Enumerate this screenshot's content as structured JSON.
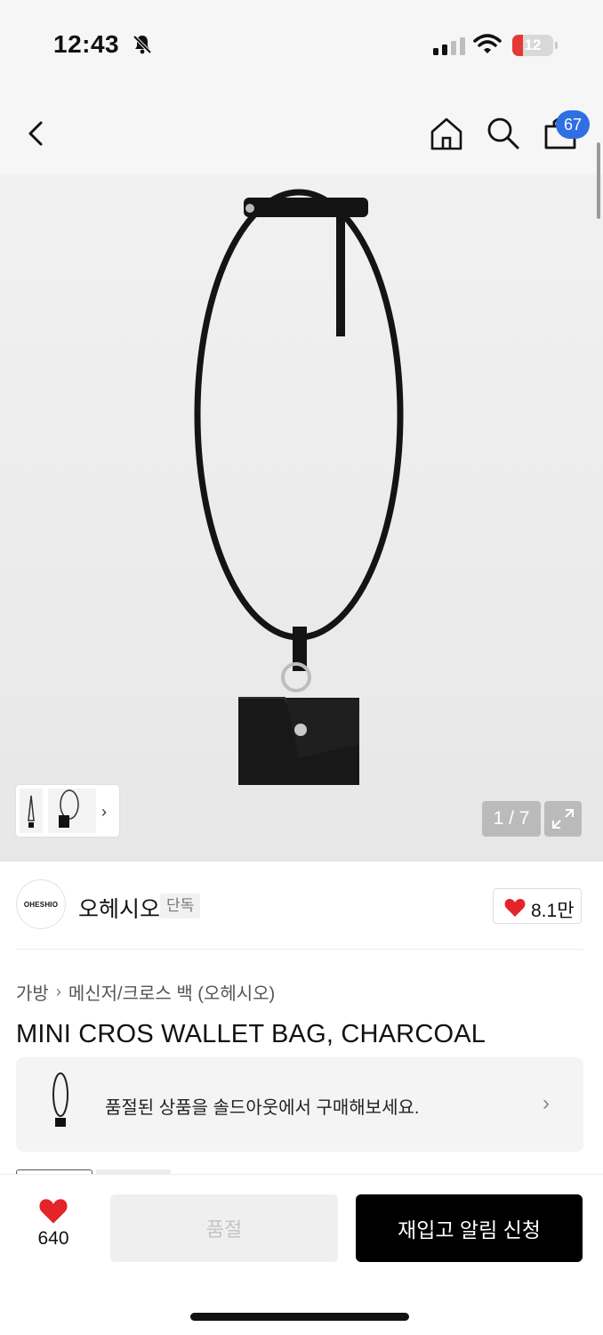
{
  "status_bar": {
    "time": "12:43",
    "battery_level": "12",
    "icons": [
      "bell-slash-icon",
      "cellular-signal-icon",
      "wifi-icon",
      "battery-icon"
    ]
  },
  "nav": {
    "icons": [
      "chevron-left-icon",
      "home-icon",
      "search-icon",
      "shopping-bag-icon"
    ],
    "cart_count": "67"
  },
  "gallery": {
    "page_indicator": "1 / 7",
    "thumb_icon": "chevron-right-icon",
    "expand_icon": "expand-icon"
  },
  "brand": {
    "logo_text": "OHESHIO",
    "name": "오헤시오",
    "exclusive_badge": "단독",
    "like_count": "8.1만"
  },
  "breadcrumb": {
    "category": "가방",
    "subcategory": "메신저/크로스 백 (오헤시오)"
  },
  "product": {
    "title": "MINI CROS WALLET BAG, CHARCOAL"
  },
  "soldout_banner": {
    "message": "품절된 상품을 솔드아웃에서 구매해보세요."
  },
  "bottom_bar": {
    "wish_count": "640",
    "soldout_label": "품절",
    "restock_label": "재입고 알림 신청"
  },
  "colors": {
    "accent_blue": "#2f6fe4",
    "heart_red": "#e3242b",
    "cta_black": "#000000"
  }
}
